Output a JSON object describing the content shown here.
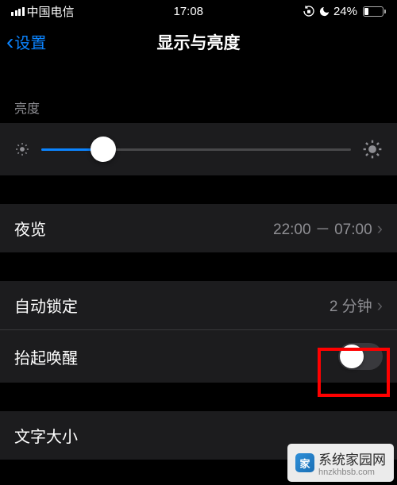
{
  "statusBar": {
    "carrier": "中国电信",
    "time": "17:08",
    "battery": "24%"
  },
  "nav": {
    "back": "设置",
    "title": "显示与亮度"
  },
  "brightness": {
    "label": "亮度"
  },
  "nightShift": {
    "label": "夜览",
    "value": "22:00 － 07:00"
  },
  "autoLock": {
    "label": "自动锁定",
    "value": "2 分钟"
  },
  "raiseToWake": {
    "label": "抬起唤醒"
  },
  "textSize": {
    "label": "文字大小"
  },
  "watermark": {
    "name": "系统家园网",
    "url": "hnzkhbsb.com"
  }
}
